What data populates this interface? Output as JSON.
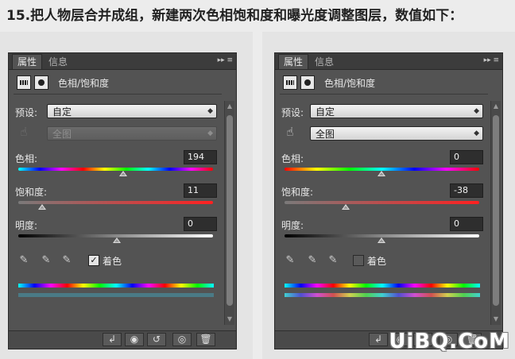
{
  "heading": "15.把人物层合并成组，新建两次色相饱和度和曝光度调整图层，数值如下：",
  "panels": [
    {
      "tabs": {
        "properties": "属性",
        "info": "信息"
      },
      "title": "色相/饱和度",
      "preset_label": "预设:",
      "preset_value": "自定",
      "channel_value": "全图",
      "channel_disabled": true,
      "hue_label": "色相:",
      "hue_value": "194",
      "saturation_label": "饱和度:",
      "saturation_value": "11",
      "lightness_label": "明度:",
      "lightness_value": "0",
      "colorize_label": "着色",
      "colorize_checked": true
    },
    {
      "tabs": {
        "properties": "属性",
        "info": "信息"
      },
      "title": "色相/饱和度",
      "preset_label": "预设:",
      "preset_value": "自定",
      "channel_value": "全图",
      "channel_disabled": false,
      "hue_label": "色相:",
      "hue_value": "0",
      "saturation_label": "饱和度:",
      "saturation_value": "-38",
      "lightness_label": "明度:",
      "lightness_value": "0",
      "colorize_label": "着色",
      "colorize_checked": false
    }
  ],
  "icons": {
    "panel_menu": "double-chevron-menu-icon",
    "preset_thumb_a": "adjustment-layer-icon",
    "preset_thumb_b": "layer-mask-icon",
    "hand": "targeted-adjustment-hand-icon",
    "eyedroppers": [
      "eyedropper-icon",
      "eyedropper-plus-icon",
      "eyedropper-minus-icon"
    ],
    "footer": [
      "clip-to-layer-icon",
      "view-previous-icon",
      "reset-icon",
      "visibility-eye-icon",
      "trash-icon"
    ]
  },
  "colors": {
    "panel_bg": "#535353",
    "spectrum_hue": "#ff0000"
  },
  "watermark": "UiBQ.CoM"
}
